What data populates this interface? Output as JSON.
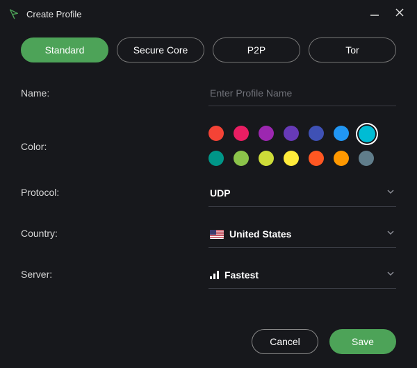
{
  "window": {
    "title": "Create Profile"
  },
  "tabs": {
    "standard": "Standard",
    "secure_core": "Secure Core",
    "p2p": "P2P",
    "tor": "Tor",
    "active": "standard"
  },
  "form": {
    "name": {
      "label": "Name:",
      "value": "",
      "placeholder": "Enter Profile Name"
    },
    "color": {
      "label": "Color:",
      "swatches": [
        "#f44336",
        "#e91e63",
        "#9c27b0",
        "#673ab7",
        "#3f51b5",
        "#2196f3",
        "#00bcd4",
        "#009688",
        "#8bc34a",
        "#cddc39",
        "#ffeb3b",
        "#ff5722",
        "#ff9800",
        "#607d8b"
      ],
      "selected_index": 6
    },
    "protocol": {
      "label": "Protocol:",
      "value": "UDP"
    },
    "country": {
      "label": "Country:",
      "value": "United States"
    },
    "server": {
      "label": "Server:",
      "value": "Fastest"
    }
  },
  "footer": {
    "cancel": "Cancel",
    "save": "Save"
  }
}
